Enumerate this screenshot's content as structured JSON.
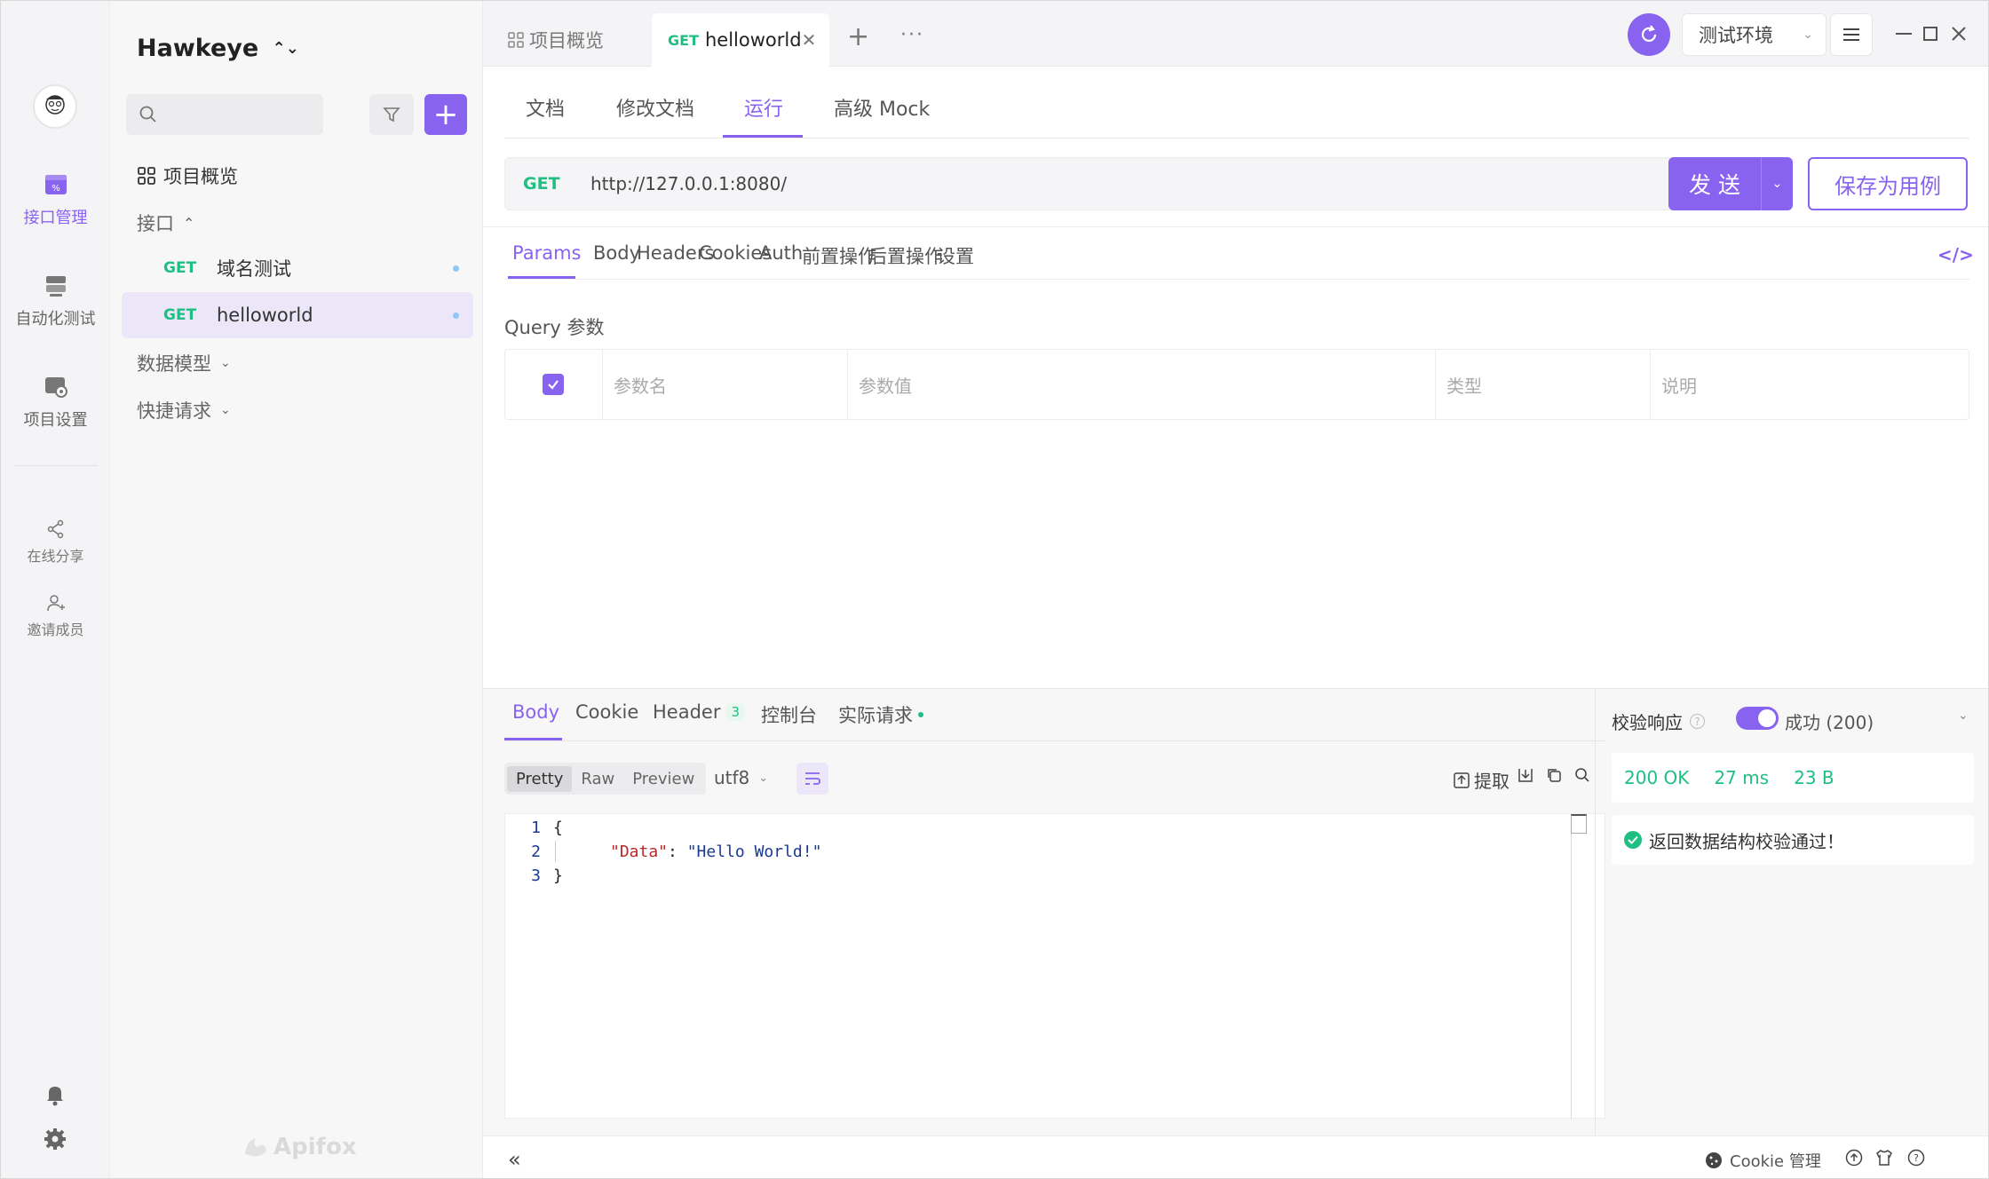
{
  "sidebar": {
    "items": [
      {
        "label": "接口管理",
        "icon": "api-icon",
        "active": true
      },
      {
        "label": "自动化测试",
        "icon": "automation-icon",
        "active": false
      },
      {
        "label": "项目设置",
        "icon": "settings-icon",
        "active": false
      }
    ],
    "share_label": "在线分享",
    "invite_label": "邀请成员"
  },
  "tree": {
    "project_name": "Hawkeye",
    "overview_label": "项目概览",
    "interface_group": "接口",
    "apis": [
      {
        "method": "GET",
        "name": "域名测试"
      },
      {
        "method": "GET",
        "name": "helloworld"
      }
    ],
    "data_model": "数据模型",
    "quick_request": "快捷请求",
    "watermark": "Apifox"
  },
  "topbar": {
    "tab_overview": "项目概览",
    "tab_active_method": "GET",
    "tab_active_name": "helloworld",
    "env": "测试环境",
    "accent": "#8863f0"
  },
  "main": {
    "subtabs": [
      "文档",
      "修改文档",
      "运行",
      "高级 Mock"
    ],
    "method": "GET",
    "url": "http://127.0.0.1:8080/",
    "send_label": "发 送",
    "save_label": "保存为用例",
    "param_tabs": [
      "Params",
      "Body",
      "Headers",
      "Cookies",
      "Auth",
      "前置操作",
      "后置操作",
      "设置"
    ],
    "query_label": "Query 参数",
    "columns": [
      "参数名",
      "参数值",
      "类型",
      "说明"
    ]
  },
  "response": {
    "tabs": [
      "Body",
      "Cookie",
      "Header",
      "控制台",
      "实际请求"
    ],
    "header_count": "3",
    "formats": [
      "Pretty",
      "Raw",
      "Preview"
    ],
    "encoding": "utf8",
    "extract_label": "提取",
    "lines": [
      "1",
      "2",
      "3"
    ],
    "code_open": "{",
    "code_key": "\"Data\"",
    "code_colon": ": ",
    "code_value": "\"Hello World!\"",
    "code_close": "}",
    "validate_label": "校验响应",
    "validate_result": "成功 (200)",
    "status": "200 OK",
    "time": "27 ms",
    "size": "23 B",
    "ok_message": "返回数据结构校验通过！"
  },
  "footer": {
    "cookie_label": "Cookie 管理"
  }
}
